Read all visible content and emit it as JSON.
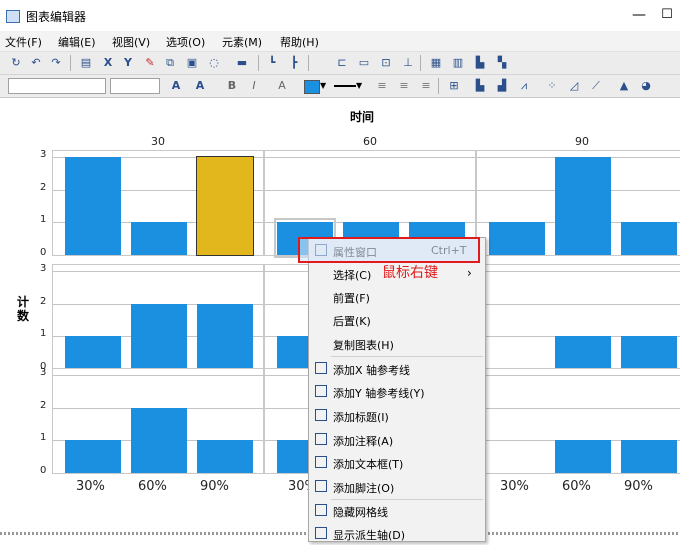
{
  "window": {
    "title": "图表编辑器",
    "min_glyph": "—",
    "max_glyph": "☐"
  },
  "menubar": [
    {
      "label": "文件(F)",
      "underline": "F"
    },
    {
      "label": "编辑(E)",
      "underline": "E"
    },
    {
      "label": "视图(V)",
      "underline": "V"
    },
    {
      "label": "选项(O)",
      "underline": "O"
    },
    {
      "label": "元素(M)",
      "underline": "M"
    },
    {
      "label": "帮助(H)",
      "underline": "H"
    }
  ],
  "toolbar1_icons": [
    "refresh-icon",
    "undo-icon",
    "redo-icon",
    "properties-icon",
    "x-axis-icon",
    "y-axis-icon",
    "edit-icon",
    "duplicate-icon",
    "delete-icon",
    "lasso-icon",
    "comment-icon",
    "ref-x-icon",
    "ref-y-icon",
    "title-icon",
    "textbox-icon",
    "footnote-icon",
    "grid-icon",
    "show-axis-icon",
    "legend-icon"
  ],
  "toolbar2_buttons": {
    "increase_font": "A",
    "decrease_font": "A",
    "bold": "B",
    "italic": "I",
    "text_style": "A"
  },
  "chart": {
    "y_title": "计数",
    "col_title": "时间",
    "columns": [
      "30",
      "60",
      "90"
    ],
    "yticks": [
      "0",
      "1",
      "2",
      "3"
    ],
    "x_labels": [
      "30%",
      "60%",
      "90%"
    ],
    "bar_color": "#1b8fe0",
    "highlight_color": "#e2b61d"
  },
  "chart_data": {
    "type": "bar",
    "title": "时间",
    "ylabel": "计数",
    "ylim": [
      0,
      3
    ],
    "categories": [
      "30%",
      "60%",
      "90%"
    ],
    "panels": [
      {
        "row": 1,
        "col": "30",
        "values": [
          3,
          1,
          3
        ]
      },
      {
        "row": 1,
        "col": "60",
        "values": [
          1,
          1,
          1
        ]
      },
      {
        "row": 1,
        "col": "90",
        "values": [
          1,
          3,
          1
        ]
      },
      {
        "row": 2,
        "col": "30",
        "values": [
          1,
          2,
          2
        ]
      },
      {
        "row": 2,
        "col": "60",
        "values": [
          1,
          null,
          null
        ]
      },
      {
        "row": 2,
        "col": "90",
        "values": [
          null,
          1,
          1
        ]
      },
      {
        "row": 3,
        "col": "30",
        "values": [
          1,
          2,
          1
        ]
      },
      {
        "row": 3,
        "col": "60",
        "values": [
          1,
          null,
          null
        ]
      },
      {
        "row": 3,
        "col": "90",
        "values": [
          null,
          1,
          1
        ]
      }
    ]
  },
  "context_menu": {
    "items": [
      {
        "label": "属性窗口",
        "shortcut": "Ctrl+T",
        "icon": "properties-icon"
      },
      {
        "label": "选择(C)",
        "submenu": "›"
      },
      {
        "label": "前置(F)"
      },
      {
        "label": "后置(K)"
      },
      {
        "label": "复制图表(H)"
      },
      {
        "label": "添加X 轴参考线",
        "icon": "x-ref-icon"
      },
      {
        "label": "添加Y 轴参考线(Y)",
        "icon": "y-ref-icon"
      },
      {
        "label": "添加标题(I)",
        "icon": "title-icon"
      },
      {
        "label": "添加注释(A)",
        "icon": "annotation-icon"
      },
      {
        "label": "添加文本框(T)",
        "icon": "textbox-icon"
      },
      {
        "label": "添加脚注(O)",
        "icon": "footnote-icon"
      },
      {
        "label": "隐藏网格线",
        "icon": "gridlines-icon"
      },
      {
        "label": "显示派生轴(D)",
        "icon": "derived-axis-icon"
      }
    ]
  },
  "annotation": {
    "text": "鼠标右键",
    "color": "#e01b1b"
  }
}
